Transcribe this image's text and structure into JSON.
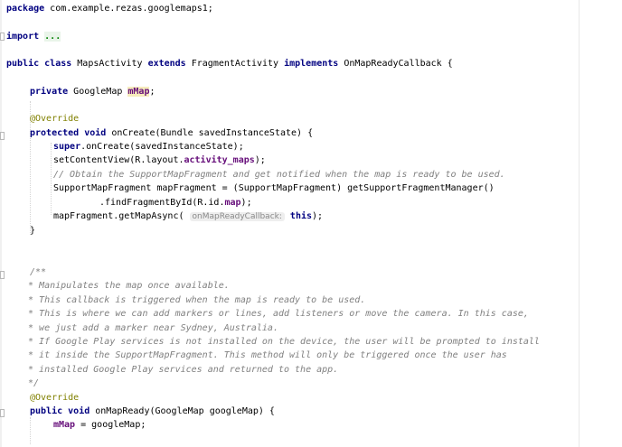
{
  "code": {
    "package_kw": "package",
    "package_name": " com.example.rezas.googlemaps1;",
    "import_kw": "import",
    "import_folded": "...",
    "class_line": {
      "public": "public",
      "class": "class",
      "name": " MapsActivity ",
      "extends": "extends",
      "super": " FragmentActivity ",
      "implements": "implements",
      "iface": " OnMapReadyCallback {"
    },
    "field_line": {
      "private": "private",
      "type": " GoogleMap ",
      "name": "mMap",
      "end": ";"
    },
    "override1": "@Override",
    "oncreate_line": {
      "protected": "protected",
      "void": "void",
      "rest": " onCreate(Bundle savedInstanceState) {"
    },
    "super_line": {
      "super": "super",
      "rest": ".onCreate(savedInstanceState);"
    },
    "setcontent_line": {
      "pre": "setContentView(R.layout.",
      "field": "activity_maps",
      "post": ");"
    },
    "comment1": "// Obtain the SupportMapFragment and get notified when the map is ready to be used.",
    "mapfrag_line": "SupportMapFragment mapFragment = (SupportMapFragment) getSupportFragmentManager()",
    "findfrag_line": {
      "pre": ".findFragmentById(R.id.",
      "field": "map",
      "post": ");"
    },
    "getmap_line": {
      "pre": "mapFragment.getMapAsync( ",
      "hint": "onMapReadyCallback:",
      "this": "this",
      "post": ");"
    },
    "close_brace1": "}",
    "javadoc": [
      "/**",
      " * Manipulates the map once available.",
      " * This callback is triggered when the map is ready to be used.",
      " * This is where we can add markers or lines, add listeners or move the camera. In this case,",
      " * we just add a marker near Sydney, Australia.",
      " * If Google Play services is not installed on the device, the user will be prompted to install",
      " * it inside the SupportMapFragment. This method will only be triggered once the user has",
      " * installed Google Play services and returned to the app.",
      " */"
    ],
    "override2": "@Override",
    "onmapready_line": {
      "public": "public",
      "void": "void",
      "rest": " onMapReady(GoogleMap googleMap) {"
    },
    "assign_line": {
      "field": "mMap",
      "rest": " = googleMap;"
    }
  }
}
